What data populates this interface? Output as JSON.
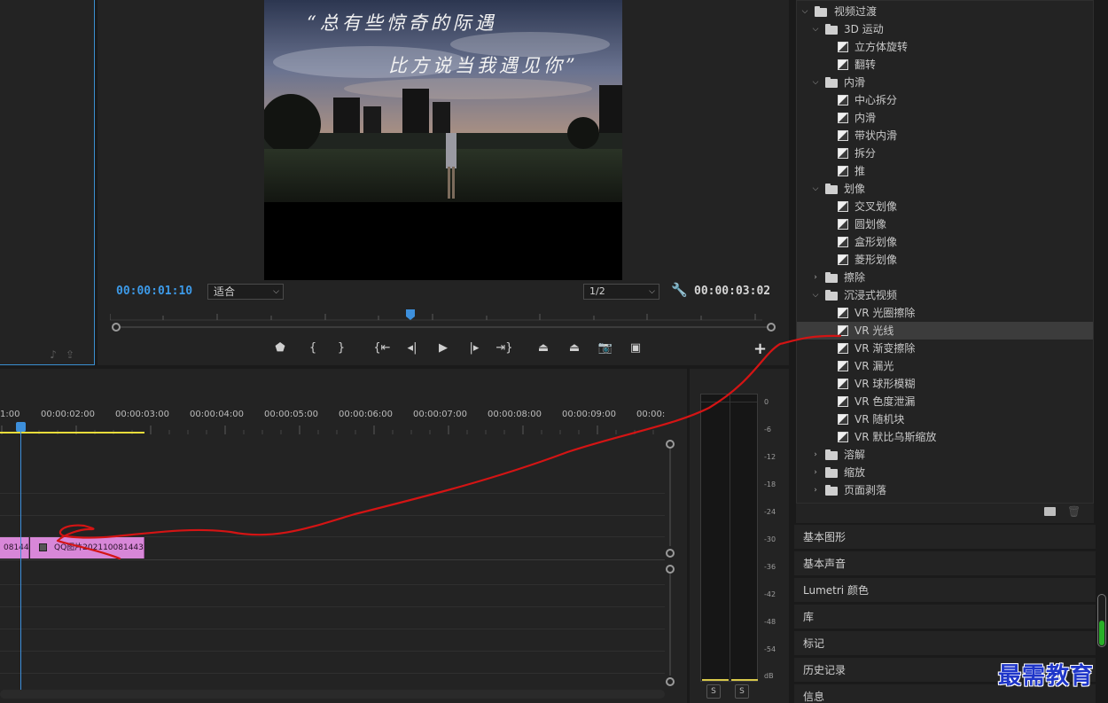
{
  "program_monitor": {
    "caption_line1": "“总有些惊奇的际遇",
    "caption_line2": "比方说当我遇见你”",
    "current_timecode": "00:00:01:10",
    "fit_select": "适合",
    "resolution_select": "1/2",
    "duration_timecode": "00:00:03:02",
    "transport_icons": [
      "marker-icon",
      "mark-in-icon",
      "mark-out-icon",
      "go-to-in-icon",
      "step-back-icon",
      "play-icon",
      "step-forward-icon",
      "go-to-out-icon",
      "lift-icon",
      "extract-icon",
      "export-frame-icon",
      "compare-icon"
    ],
    "add_button": "+"
  },
  "timeline": {
    "time_labels": [
      "1:00",
      "00:00:02:00",
      "00:00:03:00",
      "00:00:04:00",
      "00:00:05:00",
      "00:00:06:00",
      "00:00:07:00",
      "00:00:08:00",
      "00:00:09:00",
      "00:00:"
    ],
    "clip_left_label": "08144",
    "clip_right_label": "QQ图片202110081443"
  },
  "audio_meter": {
    "db_labels": [
      "0",
      "-6",
      "-12",
      "-18",
      "-24",
      "-30",
      "-36",
      "-42",
      "-48",
      "-54",
      "dB"
    ],
    "solo_left": "S",
    "solo_right": "S"
  },
  "effects_tree": [
    {
      "label": "视频过渡",
      "type": "folder",
      "expanded": true,
      "level": 0
    },
    {
      "label": "3D 运动",
      "type": "folder",
      "expanded": true,
      "level": 1
    },
    {
      "label": "立方体旋转",
      "type": "effect",
      "level": 2
    },
    {
      "label": "翻转",
      "type": "effect",
      "level": 2
    },
    {
      "label": "内滑",
      "type": "folder",
      "expanded": true,
      "level": 1
    },
    {
      "label": "中心拆分",
      "type": "effect",
      "level": 2
    },
    {
      "label": "内滑",
      "type": "effect",
      "level": 2
    },
    {
      "label": "带状内滑",
      "type": "effect",
      "level": 2
    },
    {
      "label": "拆分",
      "type": "effect",
      "level": 2
    },
    {
      "label": "推",
      "type": "effect",
      "level": 2
    },
    {
      "label": "划像",
      "type": "folder",
      "expanded": true,
      "level": 1
    },
    {
      "label": "交叉划像",
      "type": "effect",
      "level": 2
    },
    {
      "label": "圆划像",
      "type": "effect",
      "level": 2
    },
    {
      "label": "盒形划像",
      "type": "effect",
      "level": 2
    },
    {
      "label": "菱形划像",
      "type": "effect",
      "level": 2
    },
    {
      "label": "擦除",
      "type": "folder",
      "expanded": false,
      "level": 1
    },
    {
      "label": "沉浸式视频",
      "type": "folder",
      "expanded": true,
      "level": 1
    },
    {
      "label": "VR 光圈擦除",
      "type": "effect",
      "level": 2
    },
    {
      "label": "VR 光线",
      "type": "effect",
      "level": 2,
      "selected": true
    },
    {
      "label": "VR 渐变擦除",
      "type": "effect",
      "level": 2
    },
    {
      "label": "VR 漏光",
      "type": "effect",
      "level": 2
    },
    {
      "label": "VR 球形模糊",
      "type": "effect",
      "level": 2
    },
    {
      "label": "VR 色度泄漏",
      "type": "effect",
      "level": 2
    },
    {
      "label": "VR 随机块",
      "type": "effect",
      "level": 2
    },
    {
      "label": "VR 默比乌斯缩放",
      "type": "effect",
      "level": 2
    },
    {
      "label": "溶解",
      "type": "folder",
      "expanded": false,
      "level": 1
    },
    {
      "label": "缩放",
      "type": "folder",
      "expanded": false,
      "level": 1
    },
    {
      "label": "页面剥落",
      "type": "folder",
      "expanded": false,
      "level": 1
    }
  ],
  "panels": [
    "基本图形",
    "基本声音",
    "Lumetri 颜色",
    "库",
    "标记",
    "历史记录",
    "信息"
  ],
  "watermark": "最需教育",
  "colors": {
    "accent_blue": "#3d9ae8",
    "clip_pink": "#d887d8",
    "work_area_yellow": "#e8dc3a",
    "annotation_red": "#d41414",
    "watermark_blue": "#1f36c9"
  }
}
